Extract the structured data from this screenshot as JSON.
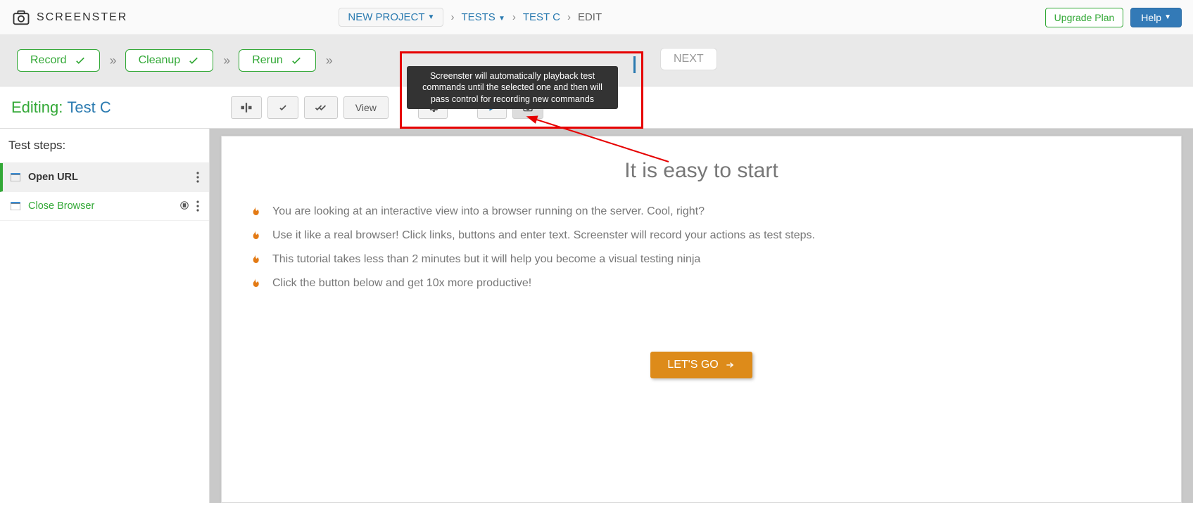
{
  "app": {
    "name": "SCREENSTER"
  },
  "breadcrumbs": {
    "project": "NEW PROJECT",
    "tests": "TESTS",
    "test": "TEST C",
    "edit": "EDIT"
  },
  "header_buttons": {
    "upgrade": "Upgrade Plan",
    "help": "Help"
  },
  "pills": {
    "record": "Record",
    "cleanup": "Cleanup",
    "rerun": "Rerun",
    "next": "NEXT"
  },
  "tooltip": "Screenster will automatically playback test commands until the selected one and then will pass control for recording new commands",
  "editing": {
    "label": "Editing:",
    "test": "Test C"
  },
  "toolbar": {
    "view": "View"
  },
  "sidebar": {
    "title": "Test steps:",
    "steps": [
      {
        "label": "Open URL"
      },
      {
        "label": "Close Browser"
      }
    ]
  },
  "content": {
    "title": "It is easy to start",
    "bullets": [
      "You are looking at an interactive view into a browser running on the server. Cool, right?",
      "Use it like a real browser! Click links, buttons and enter text. Screenster will record your actions as test steps.",
      "This tutorial takes less than 2 minutes but it will help you become a visual testing ninja",
      "Click the button below and get 10x more productive!"
    ],
    "cta": "LET'S GO"
  }
}
